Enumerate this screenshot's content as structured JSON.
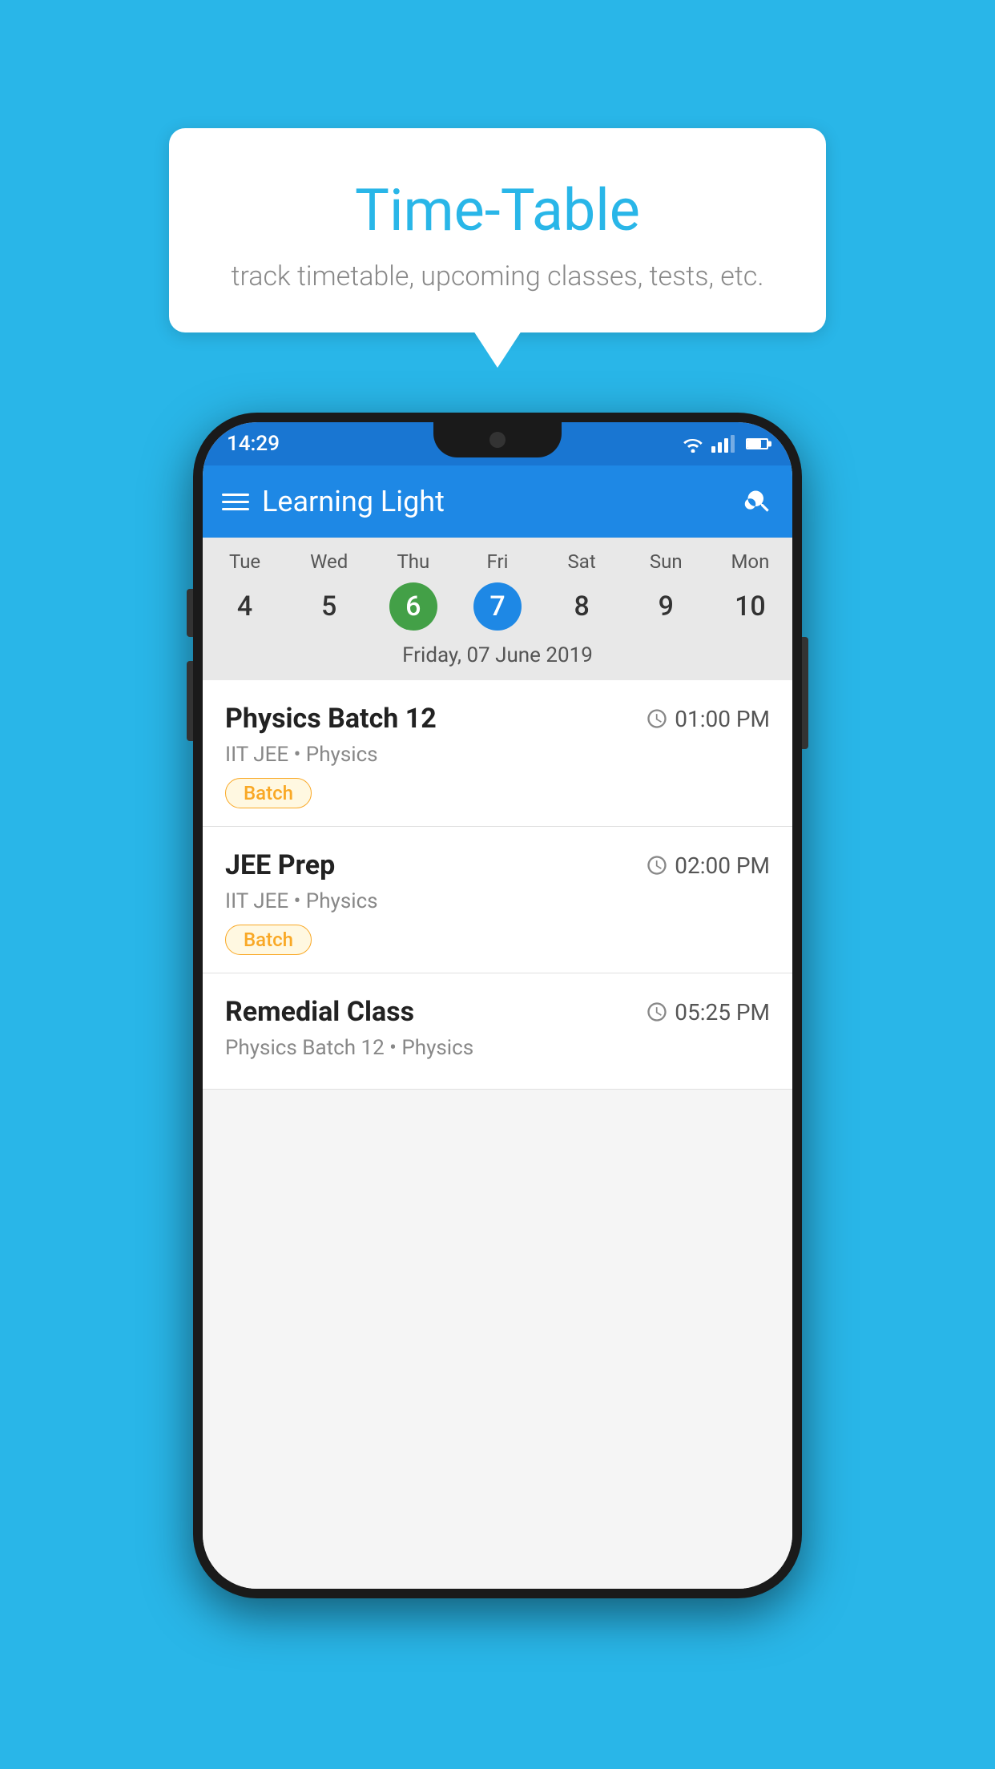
{
  "background_color": "#29B6E8",
  "tooltip": {
    "title": "Time-Table",
    "subtitle": "track timetable, upcoming classes, tests, etc."
  },
  "phone": {
    "status_bar": {
      "time": "14:29",
      "icons": [
        "wifi",
        "signal",
        "battery"
      ]
    },
    "app_bar": {
      "title": "Learning Light",
      "hamburger_label": "menu",
      "search_label": "search"
    },
    "calendar": {
      "days": [
        "Tue",
        "Wed",
        "Thu",
        "Fri",
        "Sat",
        "Sun",
        "Mon"
      ],
      "dates": [
        "4",
        "5",
        "6",
        "7",
        "8",
        "9",
        "10"
      ],
      "today_index": 2,
      "selected_index": 3,
      "selected_date_label": "Friday, 07 June 2019"
    },
    "schedule": [
      {
        "name": "Physics Batch 12",
        "time": "01:00 PM",
        "meta": "IIT JEE • Physics",
        "badge": "Batch"
      },
      {
        "name": "JEE Prep",
        "time": "02:00 PM",
        "meta": "IIT JEE • Physics",
        "badge": "Batch"
      },
      {
        "name": "Remedial Class",
        "time": "05:25 PM",
        "meta": "Physics Batch 12 • Physics",
        "badge": ""
      }
    ]
  }
}
